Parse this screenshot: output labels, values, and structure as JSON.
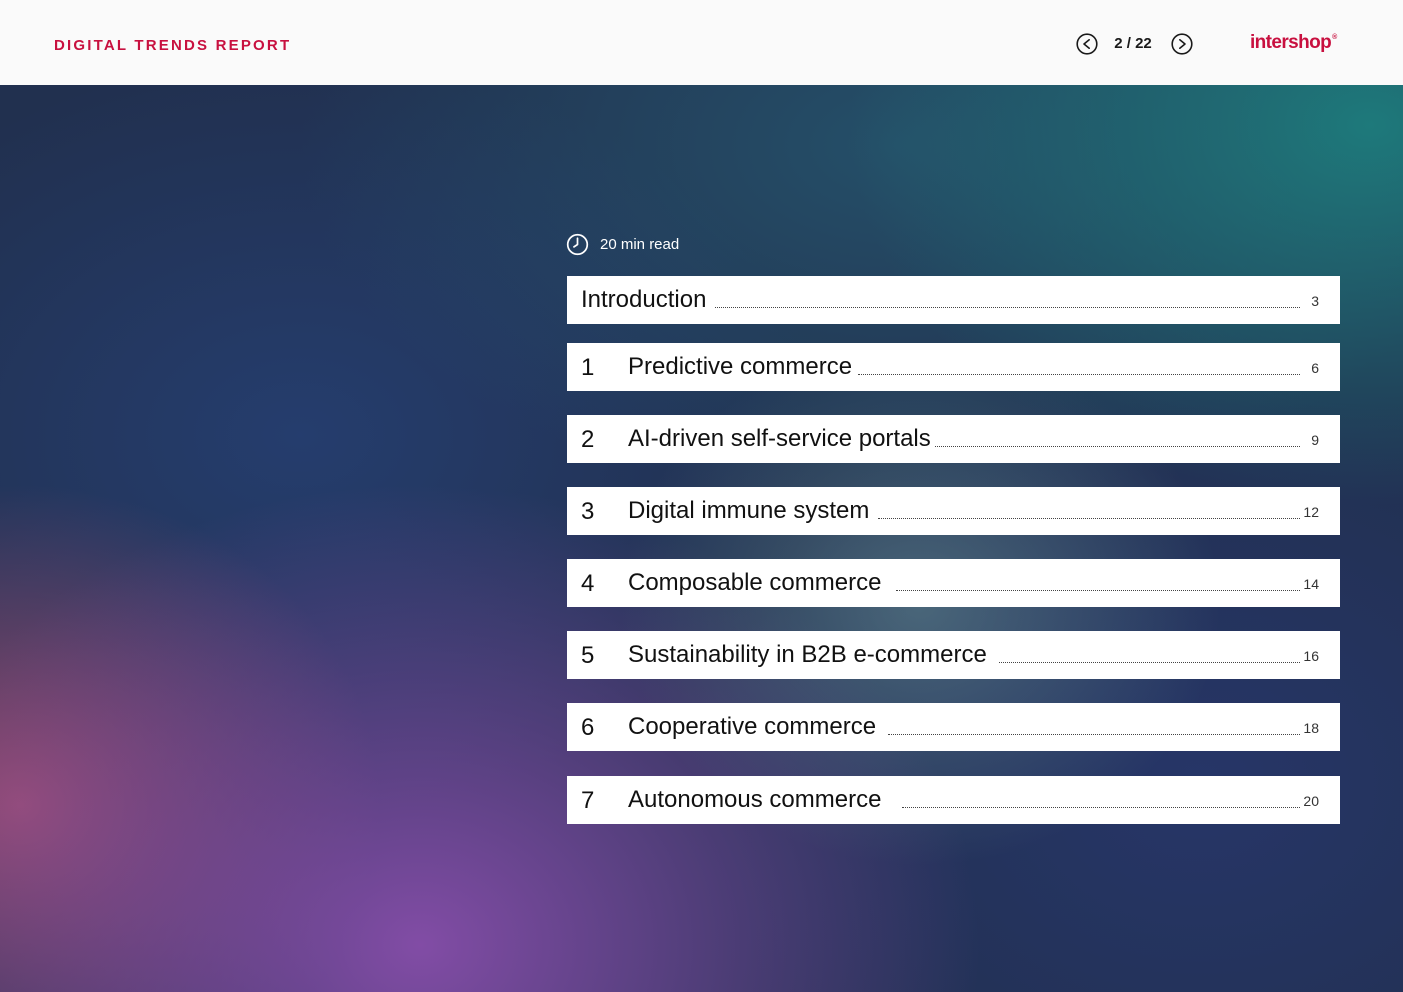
{
  "header": {
    "report_title": "DIGITAL TRENDS REPORT",
    "page_counter": "2 / 22",
    "prev_icon": "chevron-left-circle-icon",
    "next_icon": "chevron-right-circle-icon",
    "brand": "intershop",
    "brand_mark": "®",
    "brand_color": "#c8103f"
  },
  "content": {
    "read_time_icon": "clock-icon",
    "read_time": "20 min read",
    "toc": [
      {
        "number": "",
        "title": "Introduction",
        "page": "3"
      },
      {
        "number": "1",
        "title": "Predictive commerce",
        "page": "6"
      },
      {
        "number": "2",
        "title": "AI-driven self-service portals",
        "page": "9"
      },
      {
        "number": "3",
        "title": "Digital immune system",
        "page": "12"
      },
      {
        "number": "4",
        "title": "Composable commerce",
        "page": "14"
      },
      {
        "number": "5",
        "title": "Sustainability in B2B e-commerce",
        "page": "16"
      },
      {
        "number": "6",
        "title": "Cooperative commerce",
        "page": "18"
      },
      {
        "number": "7",
        "title": "Autonomous commerce",
        "page": "20"
      }
    ]
  }
}
